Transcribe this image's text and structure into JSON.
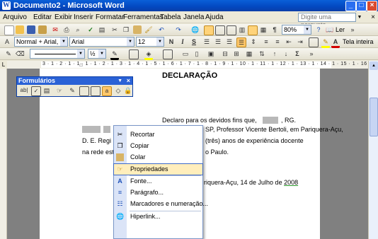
{
  "window": {
    "title": "Documento2 - Microsoft Word"
  },
  "menu": {
    "items": [
      "Arquivo",
      "Editar",
      "Exibir",
      "Inserir",
      "Formatar",
      "Ferramentas",
      "Tabela",
      "Janela",
      "Ajuda"
    ],
    "ask_placeholder": "Digite uma pergunta"
  },
  "standard_toolbar": {
    "zoom": "80%",
    "read_label": "Ler"
  },
  "format_toolbar": {
    "style": "Normal + Arial, Justi",
    "font": "Arial",
    "size": "12",
    "bold": "N",
    "italic": "I",
    "underline": "S",
    "fullscreen_label": "Tela inteira"
  },
  "drawing_toolbar": {
    "line_width": "½"
  },
  "ruler": {
    "numbers": "3 · 1 · 2 · 1 · 1 · 1 · 1 · 2 · 1 · 3 · 1 · 4 · 1 · 5 · 1 · 6 · 1 · 7 · 1 · 8 · 1 · 9 · 1 · 10 · 1 · 11 · 1 · 12 · 1 · 13 · 1 · 14 · 1 · 15 · 1 · 16 · 1 · 17"
  },
  "document": {
    "heading": "DECLARAÇÃO",
    "line1_a": "Declaro para os devidos fins que,",
    "line1_b": ", RG.",
    "line2": "SP, Professor Vicente Bertoli, em Pariquera-Açu,",
    "line3_a": "D. E. Regi",
    "line3_b": "(três) anos de experiência docente",
    "line4_a": "na rede est",
    "line4_b": "o Paulo.",
    "date_a": "riquera-Açu, 14 de Julho de ",
    "date_year": "2008"
  },
  "forms_toolbar": {
    "title": "Formulários",
    "text_field_label": "ab|"
  },
  "context_menu": {
    "items": [
      {
        "label": "Recortar",
        "icon": "scissors-icon"
      },
      {
        "label": "Copiar",
        "icon": "copy-icon"
      },
      {
        "label": "Colar",
        "icon": "paste-icon"
      },
      {
        "label": "Propriedades",
        "icon": "properties-icon",
        "highlighted": true
      },
      {
        "label": "Fonte...",
        "icon": "font-icon"
      },
      {
        "label": "Parágrafo...",
        "icon": "paragraph-icon"
      },
      {
        "label": "Marcadores e numeração...",
        "icon": "bullets-icon"
      },
      {
        "label": "Hiperlink...",
        "icon": "hyperlink-icon"
      }
    ]
  },
  "colors": {
    "titlebar": "#0a5fd8",
    "menu_highlight": "#ffeebc",
    "menu_border": "#3d6ac8",
    "redaction": "#b8b8b8",
    "font_color": "#d40000",
    "highlight_color": "#ffff00"
  }
}
